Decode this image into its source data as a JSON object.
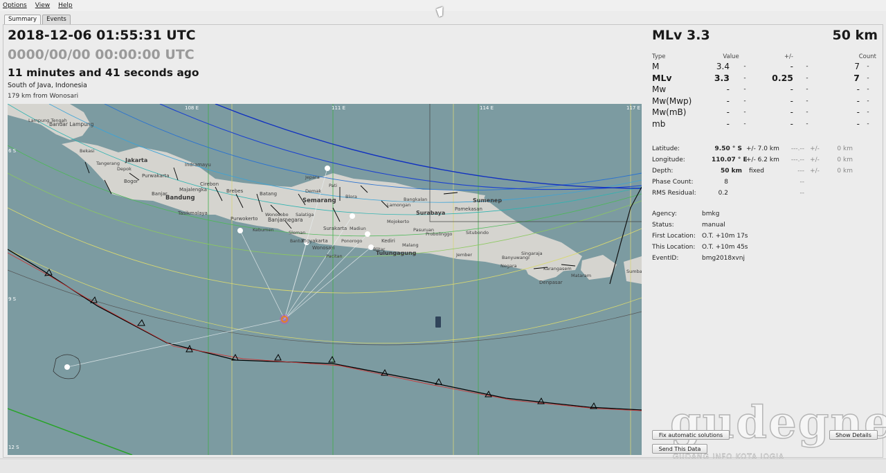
{
  "menu": {
    "options": "Options",
    "view": "View",
    "help": "Help"
  },
  "tabs": {
    "summary": "Summary",
    "events": "Events"
  },
  "origin": {
    "time": "2018-12-06 01:55:31 UTC",
    "time2": "0000/00/00  00:00:00 UTC",
    "ago": "11 minutes and 41 seconds ago",
    "region": "South of Java, Indonesia",
    "nearest": "179 km from Wonosari"
  },
  "map": {
    "lon_labels": [
      "108 E",
      "111 E",
      "114 E",
      "117 E"
    ],
    "lat_labels": [
      "6 S",
      "9 S",
      "12 S"
    ],
    "cities": [
      {
        "name": "Bandar Lampung",
        "bold": false
      },
      {
        "name": "Lampung Tengah",
        "bold": false
      },
      {
        "name": "Jakarta",
        "bold": true
      },
      {
        "name": "Bogor",
        "bold": false
      },
      {
        "name": "Depok",
        "bold": false
      },
      {
        "name": "Tangerang",
        "bold": false
      },
      {
        "name": "Bekasi",
        "bold": false
      },
      {
        "name": "Indramayu",
        "bold": false
      },
      {
        "name": "Purwakarta",
        "bold": false
      },
      {
        "name": "Cirebon",
        "bold": false
      },
      {
        "name": "Majalengka",
        "bold": false
      },
      {
        "name": "Bandung",
        "bold": true
      },
      {
        "name": "Tasikmalaya",
        "bold": false
      },
      {
        "name": "Banjar",
        "bold": false
      },
      {
        "name": "Brebes",
        "bold": false
      },
      {
        "name": "Batang",
        "bold": false
      },
      {
        "name": "Purwokerto",
        "bold": false
      },
      {
        "name": "Banjarnegara",
        "bold": false
      },
      {
        "name": "Wonosobo",
        "bold": false
      },
      {
        "name": "Kebumen",
        "bold": false
      },
      {
        "name": "Jepara",
        "bold": false
      },
      {
        "name": "Pati",
        "bold": false
      },
      {
        "name": "Demak",
        "bold": false
      },
      {
        "name": "Semarang",
        "bold": true
      },
      {
        "name": "Blora",
        "bold": false
      },
      {
        "name": "Salatiga",
        "bold": false
      },
      {
        "name": "Surakarta",
        "bold": false
      },
      {
        "name": "Sleman",
        "bold": false
      },
      {
        "name": "Yogyakarta",
        "bold": false
      },
      {
        "name": "Wonosari",
        "bold": false
      },
      {
        "name": "Bantul",
        "bold": false
      },
      {
        "name": "Ponorogo",
        "bold": false
      },
      {
        "name": "Madiun",
        "bold": false
      },
      {
        "name": "Kediri",
        "bold": false
      },
      {
        "name": "Tulungagung",
        "bold": true
      },
      {
        "name": "Blitar",
        "bold": false
      },
      {
        "name": "Pacitan",
        "bold": false
      },
      {
        "name": "Mojokerto",
        "bold": false
      },
      {
        "name": "Surabaya",
        "bold": true
      },
      {
        "name": "Lamongan",
        "bold": false
      },
      {
        "name": "Bangkalan",
        "bold": false
      },
      {
        "name": "Pamekasan",
        "bold": false
      },
      {
        "name": "Sumenep",
        "bold": true
      },
      {
        "name": "Pasuruan",
        "bold": false
      },
      {
        "name": "Probolinggo",
        "bold": false
      },
      {
        "name": "Malang",
        "bold": false
      },
      {
        "name": "Situbondo",
        "bold": false
      },
      {
        "name": "Jember",
        "bold": false
      },
      {
        "name": "Banyuwangi",
        "bold": false
      },
      {
        "name": "Singaraja",
        "bold": false
      },
      {
        "name": "Negara",
        "bold": false
      },
      {
        "name": "Karangasem",
        "bold": false
      },
      {
        "name": "Mataram",
        "bold": false
      },
      {
        "name": "Denpasar",
        "bold": false
      },
      {
        "name": "Sumbawa",
        "bold": false
      }
    ]
  },
  "magnitude": {
    "title": "MLv 3.3",
    "depth_title": "50 km",
    "headers": {
      "type": "Type",
      "value": "Value",
      "pm": "+/-",
      "count": "Count"
    },
    "rows": [
      {
        "type": "M",
        "value": "3.4",
        "d1": "-",
        "pm": "-",
        "d2": "-",
        "count": "7",
        "d3": "-",
        "bold": false
      },
      {
        "type": "MLv",
        "value": "3.3",
        "d1": "-",
        "pm": "0.25",
        "d2": "-",
        "count": "7",
        "d3": "-",
        "bold": true
      },
      {
        "type": "Mw",
        "value": "-",
        "d1": "-",
        "pm": "-",
        "d2": "-",
        "count": "-",
        "d3": "-",
        "bold": false
      },
      {
        "type": "Mw(Mwp)",
        "value": "-",
        "d1": "-",
        "pm": "-",
        "d2": "-",
        "count": "-",
        "d3": "-",
        "bold": false
      },
      {
        "type": "Mw(mB)",
        "value": "-",
        "d1": "-",
        "pm": "-",
        "d2": "-",
        "count": "-",
        "d3": "-",
        "bold": false
      },
      {
        "type": "mb",
        "value": "-",
        "d1": "-",
        "pm": "-",
        "d2": "-",
        "count": "-",
        "d3": "-",
        "bold": false
      }
    ]
  },
  "location": [
    {
      "label": "Latitude:",
      "value": "9.50 ° S",
      "unc": "+/- 7.0 km",
      "v2": "---.--",
      "pm": "+/-",
      "u2": "0 km"
    },
    {
      "label": "Longitude:",
      "value": "110.07 ° E",
      "unc": "+/- 6.2 km",
      "v2": "---.--",
      "pm": "+/-",
      "u2": "0 km"
    },
    {
      "label": "Depth:",
      "value": "50 km",
      "unc": "fixed",
      "v2": "---",
      "pm": "+/-",
      "u2": "0 km"
    },
    {
      "label": "Phase Count:",
      "value": "8",
      "unc": "",
      "v2": "--",
      "pm": "",
      "u2": ""
    },
    {
      "label": "RMS Residual:",
      "value": "0.2",
      "unc": "",
      "v2": "--",
      "pm": "",
      "u2": ""
    }
  ],
  "event_info": [
    {
      "label": "Agency:",
      "value": "bmkg"
    },
    {
      "label": "Status:",
      "value": "manual"
    },
    {
      "label": "First Location:",
      "value": "O.T. +10m 17s"
    },
    {
      "label": "This Location:",
      "value": "O.T. +10m 45s"
    },
    {
      "label": "EventID:",
      "value": "bmg2018xvnj"
    }
  ],
  "buttons": {
    "fix": "Fix automatic solutions",
    "show": "Show Details",
    "send": "Send This Data"
  },
  "watermark": {
    "main": "gudegnet",
    "sub": "GUDANG INFO KOTA JOGJA"
  },
  "colors": {
    "sea": "#7c9ba1",
    "land": "#d5d4cf",
    "epicenter": "#e8821e",
    "trench": "#000000"
  }
}
